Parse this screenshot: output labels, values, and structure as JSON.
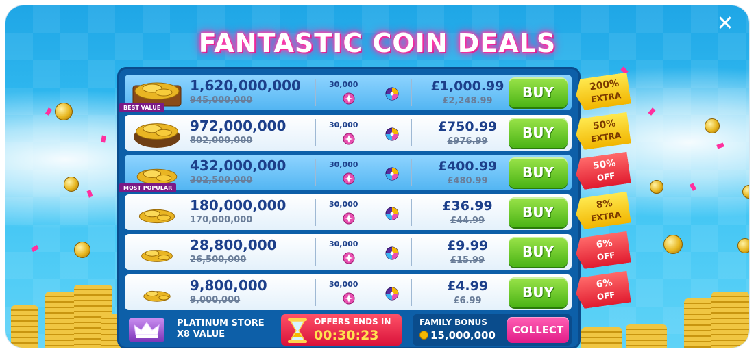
{
  "title": "FANTASTIC COIN DEALS",
  "close_label": "✕",
  "deals": [
    {
      "amount": "1,620,000,000",
      "old_amount": "945,000,000",
      "gems": "30,000",
      "price": "£1,000.99",
      "old_price": "£2,248.99",
      "buy_label": "BUY",
      "ribbon": "BEST VALUE",
      "tag_line1": "200%",
      "tag_line2": "EXTRA",
      "tag_color": "yellow",
      "row_style": "blue"
    },
    {
      "amount": "972,000,000",
      "old_amount": "802,000,000",
      "gems": "30,000",
      "price": "£750.99",
      "old_price": "£976.99",
      "buy_label": "BUY",
      "ribbon": "",
      "tag_line1": "50%",
      "tag_line2": "EXTRA",
      "tag_color": "yellow",
      "row_style": "white"
    },
    {
      "amount": "432,000,000",
      "old_amount": "302,500,000",
      "gems": "30,000",
      "price": "£400.99",
      "old_price": "£480.99",
      "buy_label": "BUY",
      "ribbon": "MOST POPULAR",
      "tag_line1": "50%",
      "tag_line2": "OFF",
      "tag_color": "red",
      "row_style": "blue"
    },
    {
      "amount": "180,000,000",
      "old_amount": "170,000,000",
      "gems": "30,000",
      "price": "£36.99",
      "old_price": "£44.99",
      "buy_label": "BUY",
      "ribbon": "",
      "tag_line1": "8%",
      "tag_line2": "EXTRA",
      "tag_color": "yellow",
      "row_style": "white"
    },
    {
      "amount": "28,800,000",
      "old_amount": "26,500,000",
      "gems": "30,000",
      "price": "£9.99",
      "old_price": "£15.99",
      "buy_label": "BUY",
      "ribbon": "",
      "tag_line1": "6%",
      "tag_line2": "OFF",
      "tag_color": "red",
      "row_style": "white"
    },
    {
      "amount": "9,800,000",
      "old_amount": "9,000,000",
      "gems": "30,000",
      "price": "£4.99",
      "old_price": "£6.99",
      "buy_label": "BUY",
      "ribbon": "",
      "tag_line1": "6%",
      "tag_line2": "OFF",
      "tag_color": "red",
      "row_style": "white"
    }
  ],
  "footer": {
    "platinum_line1": "PLATINUM STORE",
    "platinum_line2": "X8 VALUE",
    "offer_label": "OFFERS ENDS IN",
    "offer_time": "00:30:23",
    "family_label": "FAMILY BONUS",
    "family_amount": "15,000,000",
    "collect_label": "COLLECT"
  },
  "colors": {
    "panel": "#0d5fa8",
    "buy": "#4ab315",
    "title_glow": "#ff3fae",
    "collect": "#e11c88"
  }
}
